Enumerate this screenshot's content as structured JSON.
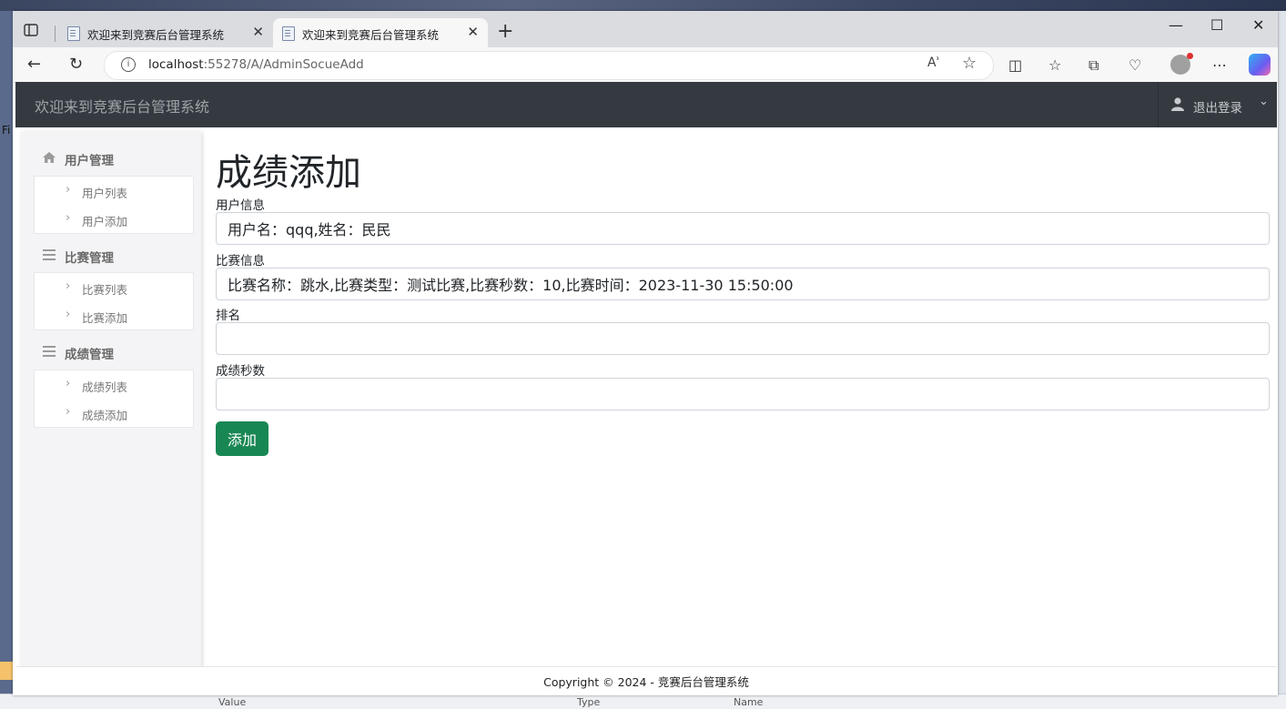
{
  "browser": {
    "tabs": [
      {
        "title": "欢迎来到竞赛后台管理系统",
        "active": false
      },
      {
        "title": "欢迎来到竞赛后台管理系统",
        "active": true
      }
    ],
    "new_tab_label": "+",
    "window_controls": {
      "minimize": "—",
      "maximize": "☐",
      "close": "✕"
    },
    "url_host": "localhost",
    "url_rest": ":55278/A/AdminSocueAdd",
    "read_aloud_label": "Aʾ",
    "icons": [
      "back-icon",
      "refresh-icon",
      "info-icon",
      "read-aloud-icon",
      "favorite-star-icon",
      "split-screen-icon",
      "favorites-icon",
      "collections-icon",
      "performance-icon",
      "profile-icon",
      "more-icon",
      "copilot-icon"
    ]
  },
  "navbar": {
    "brand": "欢迎来到竞赛后台管理系统",
    "logout_label": "退出登录"
  },
  "sidebar": {
    "groups": [
      {
        "label": "用户管理",
        "icon": "home-icon",
        "items": [
          "用户列表",
          "用户添加"
        ]
      },
      {
        "label": "比赛管理",
        "icon": "list-icon",
        "items": [
          "比赛列表",
          "比赛添加"
        ]
      },
      {
        "label": "成绩管理",
        "icon": "list-icon",
        "items": [
          "成绩列表",
          "成绩添加"
        ]
      }
    ]
  },
  "form": {
    "title": "成绩添加",
    "fields": [
      {
        "label": "用户信息",
        "value": "用户名：qqq,姓名：民民"
      },
      {
        "label": "比赛信息",
        "value": "比赛名称：跳水,比赛类型：测试比赛,比赛秒数：10,比赛时间：2023-11-30 15:50:00"
      },
      {
        "label": "排名",
        "value": ""
      },
      {
        "label": "成绩秒数",
        "value": ""
      }
    ],
    "submit_label": "添加",
    "submit_color": "#198754"
  },
  "footer": {
    "text": "Copyright © 2024 - 竞赛后台管理系统"
  },
  "background_apps": {
    "left_text": "Fi",
    "bottom_columns": [
      "Value",
      "Type",
      "Name"
    ]
  }
}
